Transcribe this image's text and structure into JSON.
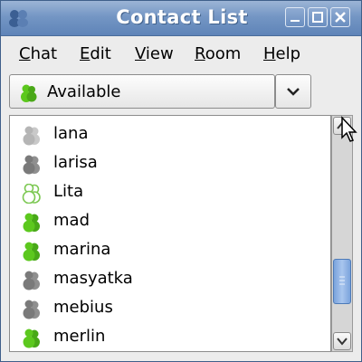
{
  "window": {
    "title": "Contact List",
    "controls": {
      "minimize_icon": "minimize-icon",
      "maximize_icon": "maximize-icon",
      "close_icon": "close-icon"
    }
  },
  "menu": [
    {
      "label": "Chat",
      "mnemonic": "C",
      "rest": "hat"
    },
    {
      "label": "Edit",
      "mnemonic": "E",
      "rest": "dit"
    },
    {
      "label": "View",
      "mnemonic": "V",
      "rest": "iew"
    },
    {
      "label": "Room",
      "mnemonic": "R",
      "rest": "oom"
    },
    {
      "label": "Help",
      "mnemonic": "H",
      "rest": "elp"
    }
  ],
  "status": {
    "selected": "Available",
    "icon": "person-available-icon"
  },
  "contacts": [
    {
      "name": "lana",
      "status": "offline-light"
    },
    {
      "name": "larisa",
      "status": "offline"
    },
    {
      "name": "Lita",
      "status": "away"
    },
    {
      "name": "mad",
      "status": "available"
    },
    {
      "name": "marina",
      "status": "available"
    },
    {
      "name": "masyatka",
      "status": "offline"
    },
    {
      "name": "mebius",
      "status": "offline"
    },
    {
      "name": "merlin",
      "status": "available"
    }
  ],
  "colors": {
    "available": "#5cc81e",
    "away_outline": "#7cc852",
    "offline": "#7a7a7a",
    "offline_light": "#b5b5b5",
    "titlebar": "#7496c4"
  }
}
